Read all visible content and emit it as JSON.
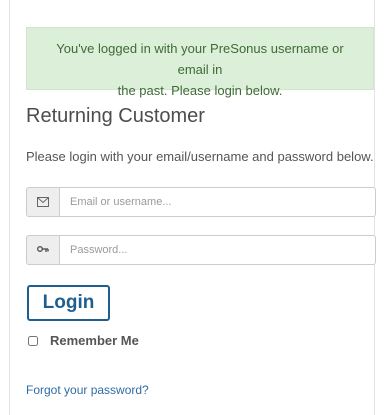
{
  "alert": {
    "line1": "You've logged in with your PreSonus username or email in",
    "line2": "the past. Please login below."
  },
  "login": {
    "title": "Returning Customer",
    "description": "Please login with your email/username and password below.",
    "email_placeholder": "Email or username...",
    "password_placeholder": "Password...",
    "login_label": "Login",
    "remember_label": "Remember Me",
    "forgot_label": "Forgot your password?"
  },
  "icons": {
    "email": "envelope-icon",
    "password": "key-icon"
  },
  "colors": {
    "alert_bg": "#dcefd9",
    "alert_text": "#3f6a36",
    "accent": "#1f5f8f",
    "link": "#2e6da4"
  }
}
